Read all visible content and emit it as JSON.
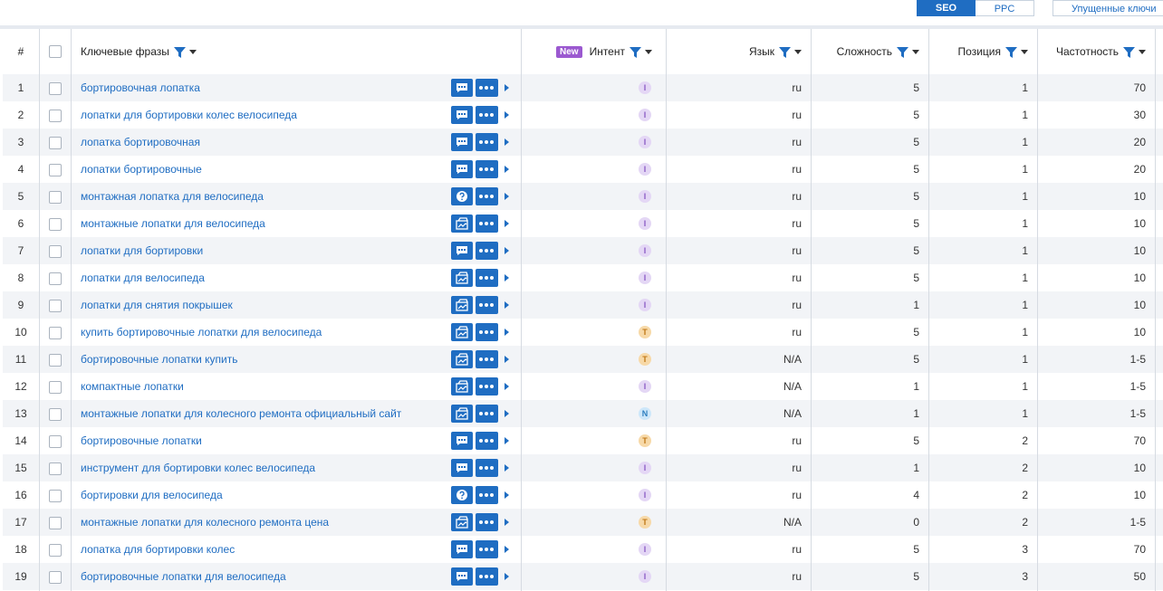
{
  "toolbar": {
    "seo_label": "SEO",
    "ppc_label": "PPC",
    "more_label": "Упущенные ключи"
  },
  "header": {
    "num": "#",
    "keywords": "Ключевые фразы",
    "new_badge": "New",
    "intent": "Интент",
    "language": "Язык",
    "difficulty": "Сложность",
    "position": "Позиция",
    "frequency": "Частотность"
  },
  "colors": {
    "accent": "#1f6dc2",
    "row_alt": "#f2f4f7",
    "new_badge": "#9b59d0"
  },
  "rows": [
    {
      "n": "1",
      "kw": "бортировочная лопатка",
      "icon": "comment",
      "intent": "I",
      "lang": "ru",
      "diff": "5",
      "pos": "1",
      "freq": "70"
    },
    {
      "n": "2",
      "kw": "лопатки для бортировки колес велосипеда",
      "icon": "comment",
      "intent": "I",
      "lang": "ru",
      "diff": "5",
      "pos": "1",
      "freq": "30"
    },
    {
      "n": "3",
      "kw": "лопатка бортировочная",
      "icon": "comment",
      "intent": "I",
      "lang": "ru",
      "diff": "5",
      "pos": "1",
      "freq": "20"
    },
    {
      "n": "4",
      "kw": "лопатки бортировочные",
      "icon": "comment",
      "intent": "I",
      "lang": "ru",
      "diff": "5",
      "pos": "1",
      "freq": "20"
    },
    {
      "n": "5",
      "kw": "монтажная лопатка для велосипеда",
      "icon": "question",
      "intent": "I",
      "lang": "ru",
      "diff": "5",
      "pos": "1",
      "freq": "10"
    },
    {
      "n": "6",
      "kw": "монтажные лопатки для велосипеда",
      "icon": "image",
      "intent": "I",
      "lang": "ru",
      "diff": "5",
      "pos": "1",
      "freq": "10"
    },
    {
      "n": "7",
      "kw": "лопатки для бортировки",
      "icon": "comment",
      "intent": "I",
      "lang": "ru",
      "diff": "5",
      "pos": "1",
      "freq": "10"
    },
    {
      "n": "8",
      "kw": "лопатки для велосипеда",
      "icon": "image",
      "intent": "I",
      "lang": "ru",
      "diff": "5",
      "pos": "1",
      "freq": "10"
    },
    {
      "n": "9",
      "kw": "лопатки для снятия покрышек",
      "icon": "image",
      "intent": "I",
      "lang": "ru",
      "diff": "1",
      "pos": "1",
      "freq": "10"
    },
    {
      "n": "10",
      "kw": "купить бортировочные лопатки для велосипеда",
      "icon": "image",
      "intent": "T",
      "lang": "ru",
      "diff": "5",
      "pos": "1",
      "freq": "10"
    },
    {
      "n": "11",
      "kw": "бортировочные лопатки купить",
      "icon": "image",
      "intent": "T",
      "lang": "N/A",
      "diff": "5",
      "pos": "1",
      "freq": "1-5"
    },
    {
      "n": "12",
      "kw": "компактные лопатки",
      "icon": "image",
      "intent": "I",
      "lang": "N/A",
      "diff": "1",
      "pos": "1",
      "freq": "1-5"
    },
    {
      "n": "13",
      "kw": "монтажные лопатки для колесного ремонта официальный сайт",
      "icon": "image",
      "intent": "N",
      "lang": "N/A",
      "diff": "1",
      "pos": "1",
      "freq": "1-5"
    },
    {
      "n": "14",
      "kw": "бортировочные лопатки",
      "icon": "comment",
      "intent": "T",
      "lang": "ru",
      "diff": "5",
      "pos": "2",
      "freq": "70"
    },
    {
      "n": "15",
      "kw": "инструмент для бортировки колес велосипеда",
      "icon": "comment",
      "intent": "I",
      "lang": "ru",
      "diff": "1",
      "pos": "2",
      "freq": "10"
    },
    {
      "n": "16",
      "kw": "бортировки для велосипеда",
      "icon": "question",
      "intent": "I",
      "lang": "ru",
      "diff": "4",
      "pos": "2",
      "freq": "10"
    },
    {
      "n": "17",
      "kw": "монтажные лопатки для колесного ремонта цена",
      "icon": "image",
      "intent": "T",
      "lang": "N/A",
      "diff": "0",
      "pos": "2",
      "freq": "1-5"
    },
    {
      "n": "18",
      "kw": "лопатка для бортировки колес",
      "icon": "comment",
      "intent": "I",
      "lang": "ru",
      "diff": "5",
      "pos": "3",
      "freq": "70"
    },
    {
      "n": "19",
      "kw": "бортировочные лопатки для велосипеда",
      "icon": "comment",
      "intent": "I",
      "lang": "ru",
      "diff": "5",
      "pos": "3",
      "freq": "50"
    }
  ]
}
